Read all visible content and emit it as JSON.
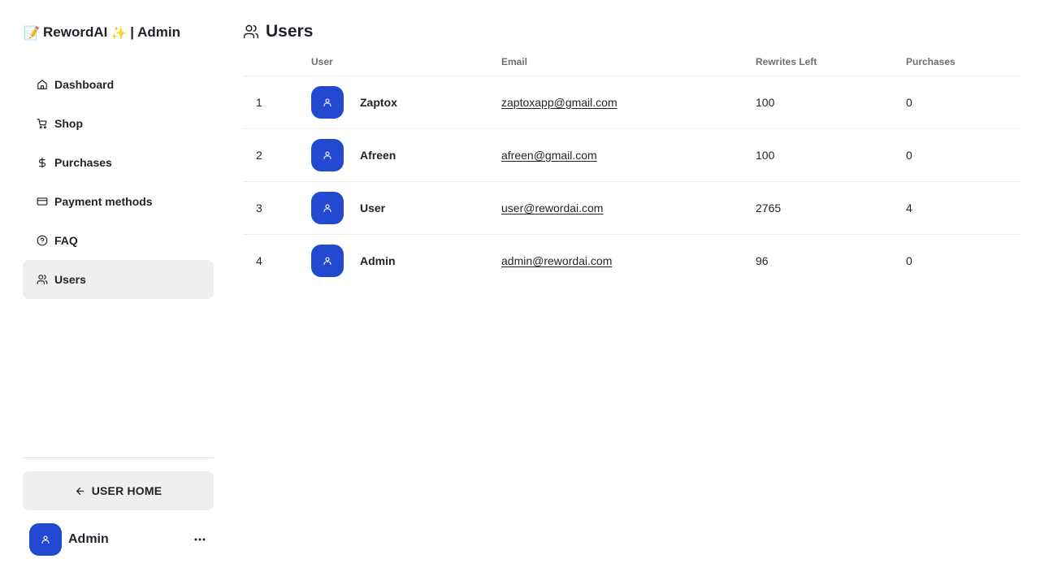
{
  "app": {
    "brand_emoji": "📝",
    "brand_name": "RewordAI",
    "brand_sparkle": "✨",
    "brand_suffix": "| Admin",
    "accent_color": "#2249d0"
  },
  "sidebar": {
    "items": [
      {
        "label": "Dashboard",
        "icon": "home-icon"
      },
      {
        "label": "Shop",
        "icon": "cart-icon"
      },
      {
        "label": "Purchases",
        "icon": "dollar-icon"
      },
      {
        "label": "Payment methods",
        "icon": "credit-card-icon"
      },
      {
        "label": "FAQ",
        "icon": "help-circle-icon"
      },
      {
        "label": "Users",
        "icon": "users-icon",
        "active": true
      }
    ],
    "user_home_label": "USER HOME",
    "profile_name": "Admin"
  },
  "main": {
    "title": "Users",
    "columns": [
      "",
      "User",
      "Email",
      "Rewrites Left",
      "Purchases"
    ],
    "rows": [
      {
        "index": "1",
        "name": "Zaptox",
        "email": "zaptoxapp@gmail.com",
        "rewrites_left": "100",
        "purchases": "0"
      },
      {
        "index": "2",
        "name": "Afreen",
        "email": "afreen@gmail.com",
        "rewrites_left": "100",
        "purchases": "0"
      },
      {
        "index": "3",
        "name": "User",
        "email": "user@rewordai.com",
        "rewrites_left": "2765",
        "purchases": "4"
      },
      {
        "index": "4",
        "name": "Admin",
        "email": "admin@rewordai.com",
        "rewrites_left": "96",
        "purchases": "0"
      }
    ]
  }
}
